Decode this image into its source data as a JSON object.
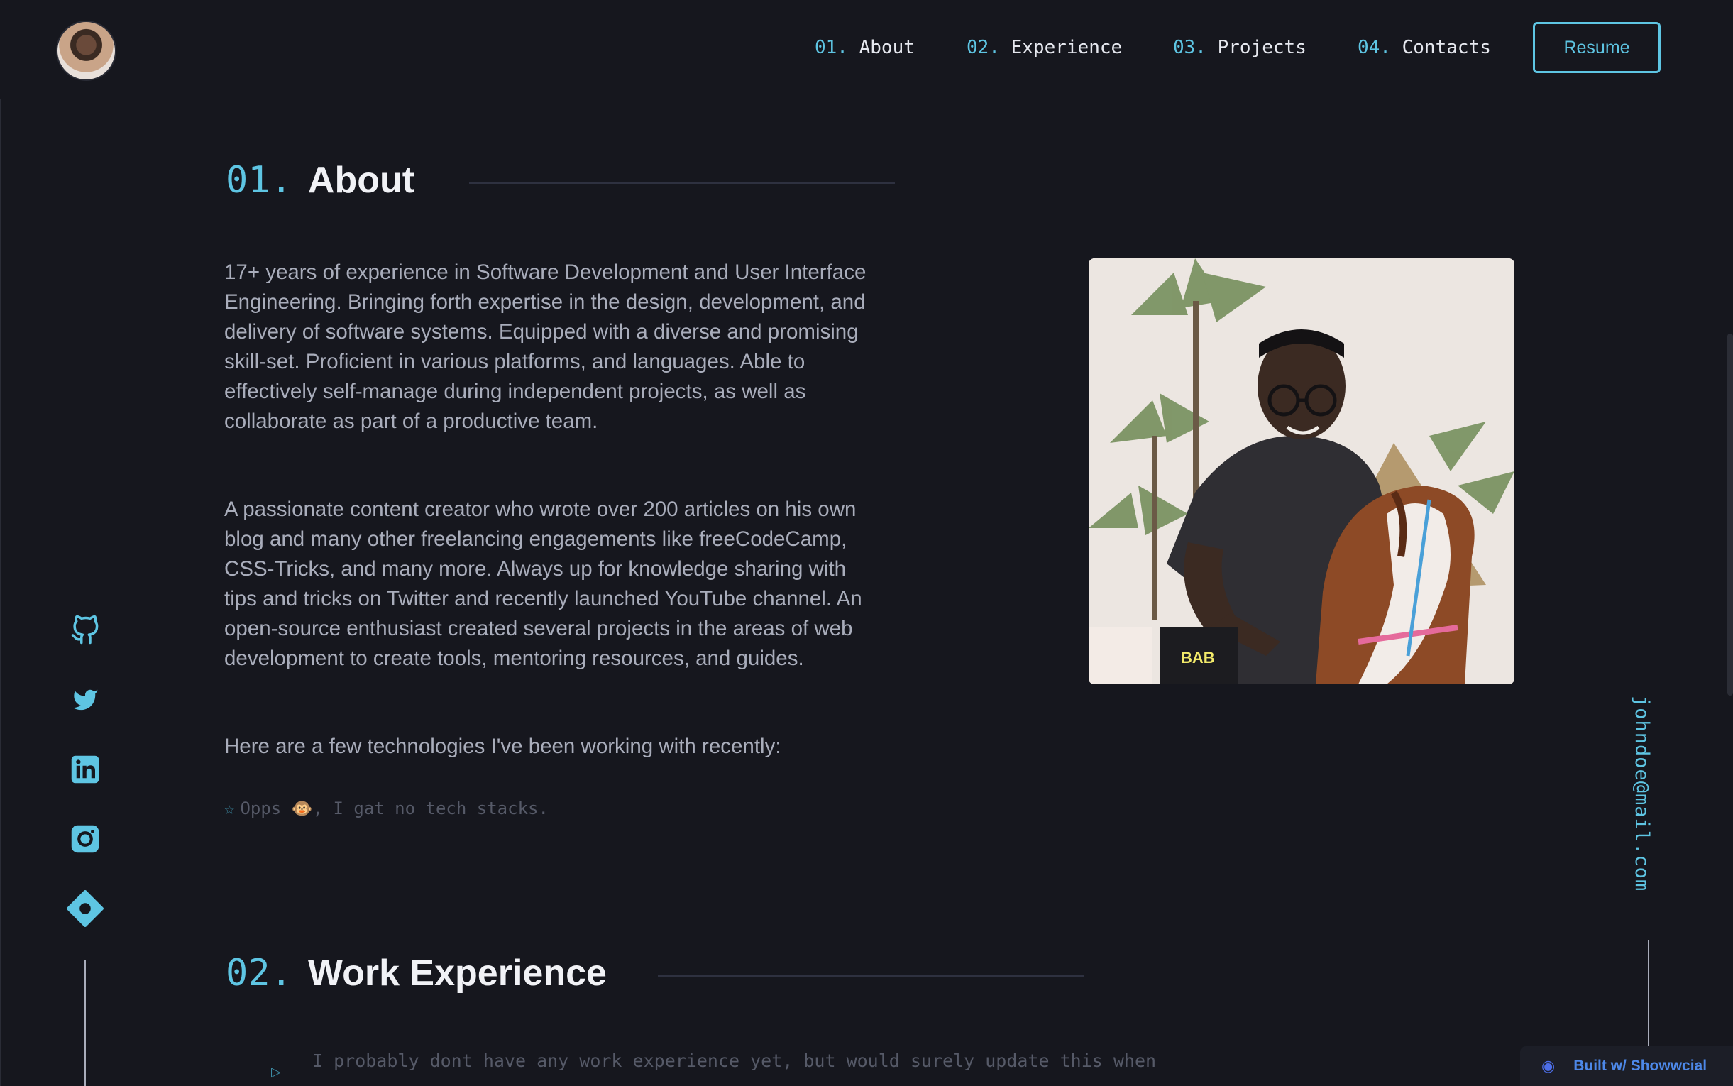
{
  "header": {
    "nav": [
      {
        "num": "01.",
        "label": "About"
      },
      {
        "num": "02.",
        "label": "Experience"
      },
      {
        "num": "03.",
        "label": "Projects"
      },
      {
        "num": "04.",
        "label": "Contacts"
      }
    ],
    "resume_label": "Resume"
  },
  "about": {
    "num": "01.",
    "title": "About",
    "paragraphs": [
      "17+ years of experience in Software Development and User Interface Engineering. Bringing forth expertise in the design, development, and delivery of software systems. Equipped with a diverse and promising skill-set. Proficient in various platforms, and languages. Able to effectively self-manage during independent projects, as well as collaborate as part of a productive team.",
      "A passionate content creator who wrote over 200 articles on his own blog and many other freelancing engagements like freeCodeCamp, CSS-Tricks, and many more. Always up for knowledge sharing with tips and tricks on Twitter and recently launched YouTube channel. An open-source enthusiast created several projects in the areas of web development to create tools, mentoring resources, and guides.",
      "Here are a few technologies I've been working with recently:"
    ],
    "tech_note": "Opps 🐵, I gat no tech stacks."
  },
  "experience": {
    "num": "02.",
    "title": "Work Experience",
    "note": "I probably dont have any work experience yet, but would surely update this when"
  },
  "social": {
    "icons": [
      "github-icon",
      "twitter-icon",
      "linkedin-icon",
      "instagram-icon",
      "hashnode-icon"
    ]
  },
  "email": "johndoe@mail.com",
  "badge": "Built w/ Showwcial",
  "colors": {
    "accent": "#5ec5e3",
    "background": "#16171e",
    "text": "#a9adbb",
    "heading": "#f1f2f6"
  }
}
